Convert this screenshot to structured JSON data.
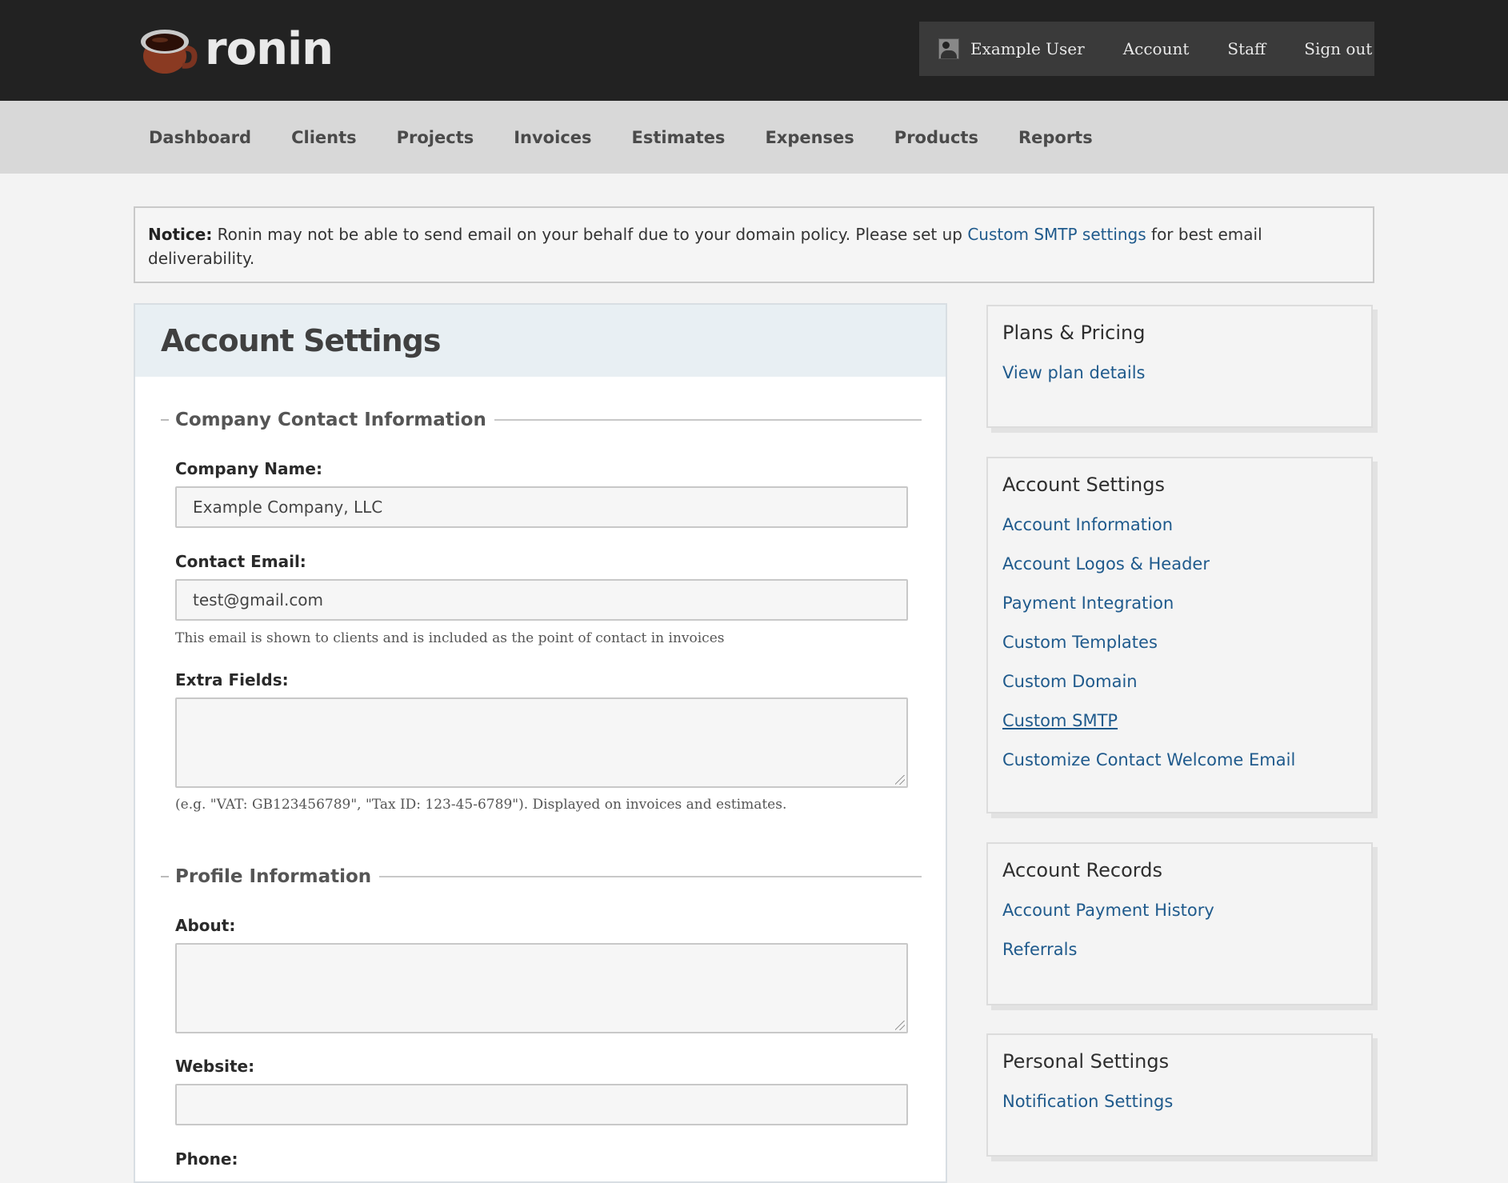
{
  "header": {
    "logo_text": "ronin",
    "user_menu": [
      {
        "id": "user",
        "label": "Example User"
      },
      {
        "id": "account",
        "label": "Account"
      },
      {
        "id": "staff",
        "label": "Staff"
      },
      {
        "id": "signout",
        "label": "Sign out"
      }
    ]
  },
  "nav": {
    "items": [
      "Dashboard",
      "Clients",
      "Projects",
      "Invoices",
      "Estimates",
      "Expenses",
      "Products",
      "Reports"
    ]
  },
  "notice": {
    "label": "Notice:",
    "text_before": " Ronin may not be able to send email on your behalf due to your domain policy. Please set up ",
    "link": "Custom SMTP settings",
    "text_after": " for best email deliverability."
  },
  "main": {
    "title": "Account Settings",
    "company_section": {
      "legend": "Company Contact Information",
      "company_name_label": "Company Name:",
      "company_name_value": "Example Company, LLC",
      "contact_email_label": "Contact Email:",
      "contact_email_value": "test@gmail.com",
      "contact_email_hint": "This email is shown to clients and is included as the point of contact in invoices",
      "extra_fields_label": "Extra Fields:",
      "extra_fields_value": "",
      "extra_fields_hint": "(e.g. \"VAT: GB123456789\", \"Tax ID: 123-45-6789\"). Displayed on invoices and estimates."
    },
    "profile_section": {
      "legend": "Profile Information",
      "about_label": "About:",
      "about_value": "",
      "website_label": "Website:",
      "website_value": "",
      "phone_label": "Phone:"
    }
  },
  "sidebar": {
    "plans": {
      "title": "Plans & Pricing",
      "links": [
        "View plan details"
      ]
    },
    "account_settings": {
      "title": "Account Settings",
      "links": [
        "Account Information",
        "Account Logos & Header",
        "Payment Integration",
        "Custom Templates",
        "Custom Domain",
        "Custom SMTP",
        "Customize Contact Welcome Email"
      ]
    },
    "records": {
      "title": "Account Records",
      "links": [
        "Account Payment History",
        "Referrals"
      ]
    },
    "personal": {
      "title": "Personal Settings",
      "links": [
        "Notification Settings"
      ]
    }
  },
  "colors": {
    "header_bg": "#222222",
    "nav_bg": "#d8d8d8",
    "link": "#1f5a8c",
    "logo_cup": "#8a3a22"
  }
}
